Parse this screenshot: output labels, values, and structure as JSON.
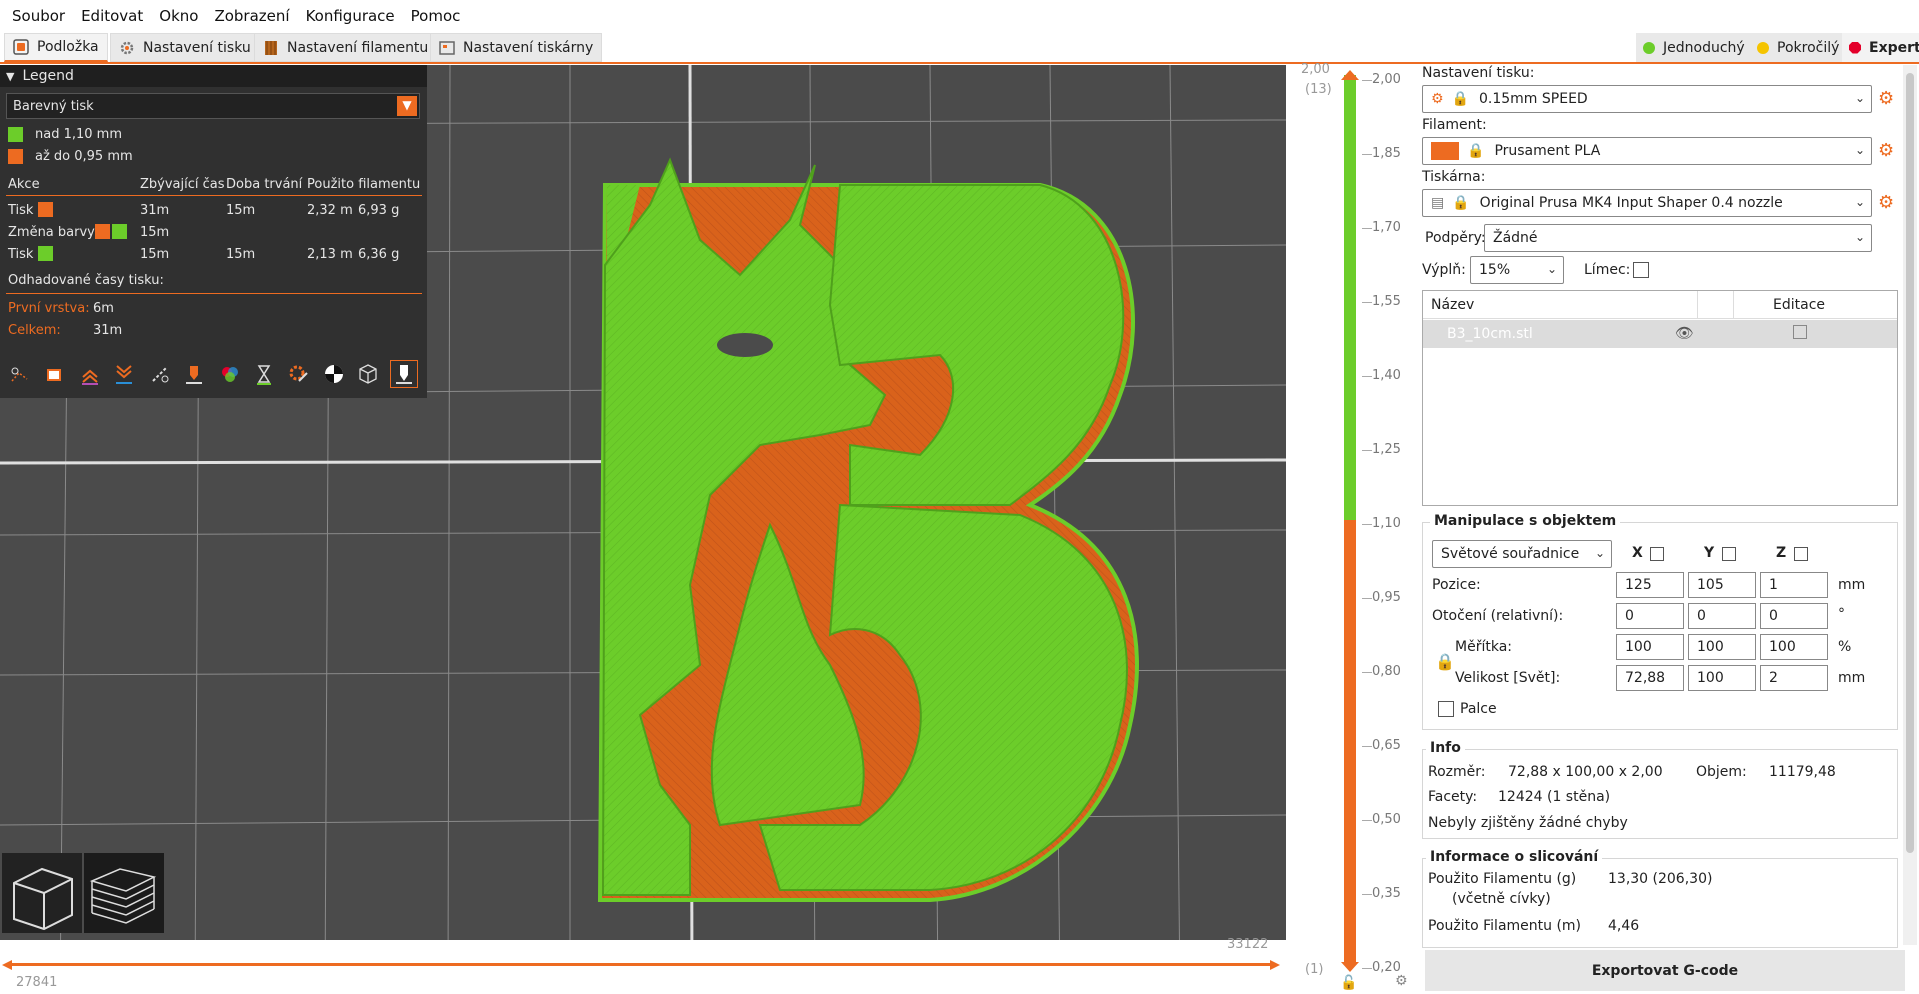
{
  "menu": [
    "Soubor",
    "Editovat",
    "Okno",
    "Zobrazení",
    "Konfigurace",
    "Pomoc"
  ],
  "tabs": {
    "plater": "Podložka",
    "print": "Nastavení tisku",
    "filament": "Nastavení filamentu",
    "printer": "Nastavení tiskárny"
  },
  "modes": {
    "simple": "Jednoduchý",
    "advanced": "Pokročilý",
    "expert": "Expert"
  },
  "colors": {
    "accent": "#ed6b21",
    "green": "#6ccd2a",
    "yellow": "#f5c400",
    "red": "#e4002b"
  },
  "legend": {
    "title": "Legend",
    "view_type": "Barevný tisk",
    "items": [
      "nad 1,10 mm",
      "až do 0,95 mm"
    ],
    "columns": [
      "Akce",
      "Zbývající čas",
      "Doba trvání",
      "Použito filamentu"
    ],
    "rows": [
      {
        "action": "Tisk",
        "remaining": "31m",
        "duration": "15m",
        "length": "2,32 m",
        "weight": "6,93 g"
      },
      {
        "action": "Změna barvy",
        "remaining": "15m",
        "duration": "",
        "length": "",
        "weight": ""
      },
      {
        "action": "Tisk",
        "remaining": "15m",
        "duration": "15m",
        "length": "2,13 m",
        "weight": "6,36 g"
      }
    ],
    "estimated": "Odhadované časy tisku:",
    "first_layer_label": "První vrstva:",
    "first_layer_value": "6m",
    "total_label": "Celkem:",
    "total_value": "31m"
  },
  "viewport": {
    "slider_left_value": "27841",
    "slider_right_value": "33122"
  },
  "layer_slider": {
    "top_value": "2,00",
    "top_layer": "(13)",
    "bottom_value": "0,20",
    "bottom_layer": "(1)",
    "ticks": [
      "2,00",
      "1,85",
      "1,70",
      "1,55",
      "1,40",
      "1,25",
      "1,10",
      "0,95",
      "0,80",
      "0,65",
      "0,50",
      "0,35",
      "0,20"
    ]
  },
  "right": {
    "print_settings_label": "Nastavení tisku:",
    "print_settings_value": "0.15mm SPEED",
    "filament_label": "Filament:",
    "filament_value": "Prusament PLA",
    "printer_label": "Tiskárna:",
    "printer_value": "Original Prusa MK4 Input Shaper 0.4 nozzle",
    "supports_label": "Podpěry:",
    "supports_value": "Žádné",
    "infill_label": "Výplň:",
    "infill_value": "15%",
    "brim_label": "Límec:",
    "objects_col_name": "Název",
    "objects_col_edit": "Editace",
    "object_name": "B3_10cm.stl"
  },
  "manip": {
    "title": "Manipulace s objektem",
    "coords": "Světové souřadnice",
    "axes": [
      "X",
      "Y",
      "Z"
    ],
    "position_label": "Pozice:",
    "position": [
      "125",
      "105",
      "1"
    ],
    "position_unit": "mm",
    "rotation_label": "Otočení (relativní):",
    "rotation": [
      "0",
      "0",
      "0"
    ],
    "rotation_unit": "°",
    "scale_label": "Měřítka:",
    "scale": [
      "100",
      "100",
      "100"
    ],
    "scale_unit": "%",
    "size_label": "Velikost [Svět]:",
    "size": [
      "72,88",
      "100",
      "2"
    ],
    "size_unit": "mm",
    "inches_label": "Palce"
  },
  "info": {
    "title": "Info",
    "size_label": "Rozměr:",
    "size_value": "72,88 x 100,00 x 2,00",
    "volume_label": "Objem:",
    "volume_value": "11179,48",
    "facets_label": "Facety:",
    "facets_value": "12424 (1 stěna)",
    "errors": "Nebyly zjištěny žádné chyby"
  },
  "slicing": {
    "title": "Informace o slicování",
    "fil_g_label": "Použito Filamentu (g)",
    "fil_g_sub": "(včetně cívky)",
    "fil_g_value": "13,30 (206,30)",
    "fil_m_label": "Použito Filamentu (m)",
    "fil_m_value": "4,46"
  },
  "export_label": "Exportovat G-code"
}
